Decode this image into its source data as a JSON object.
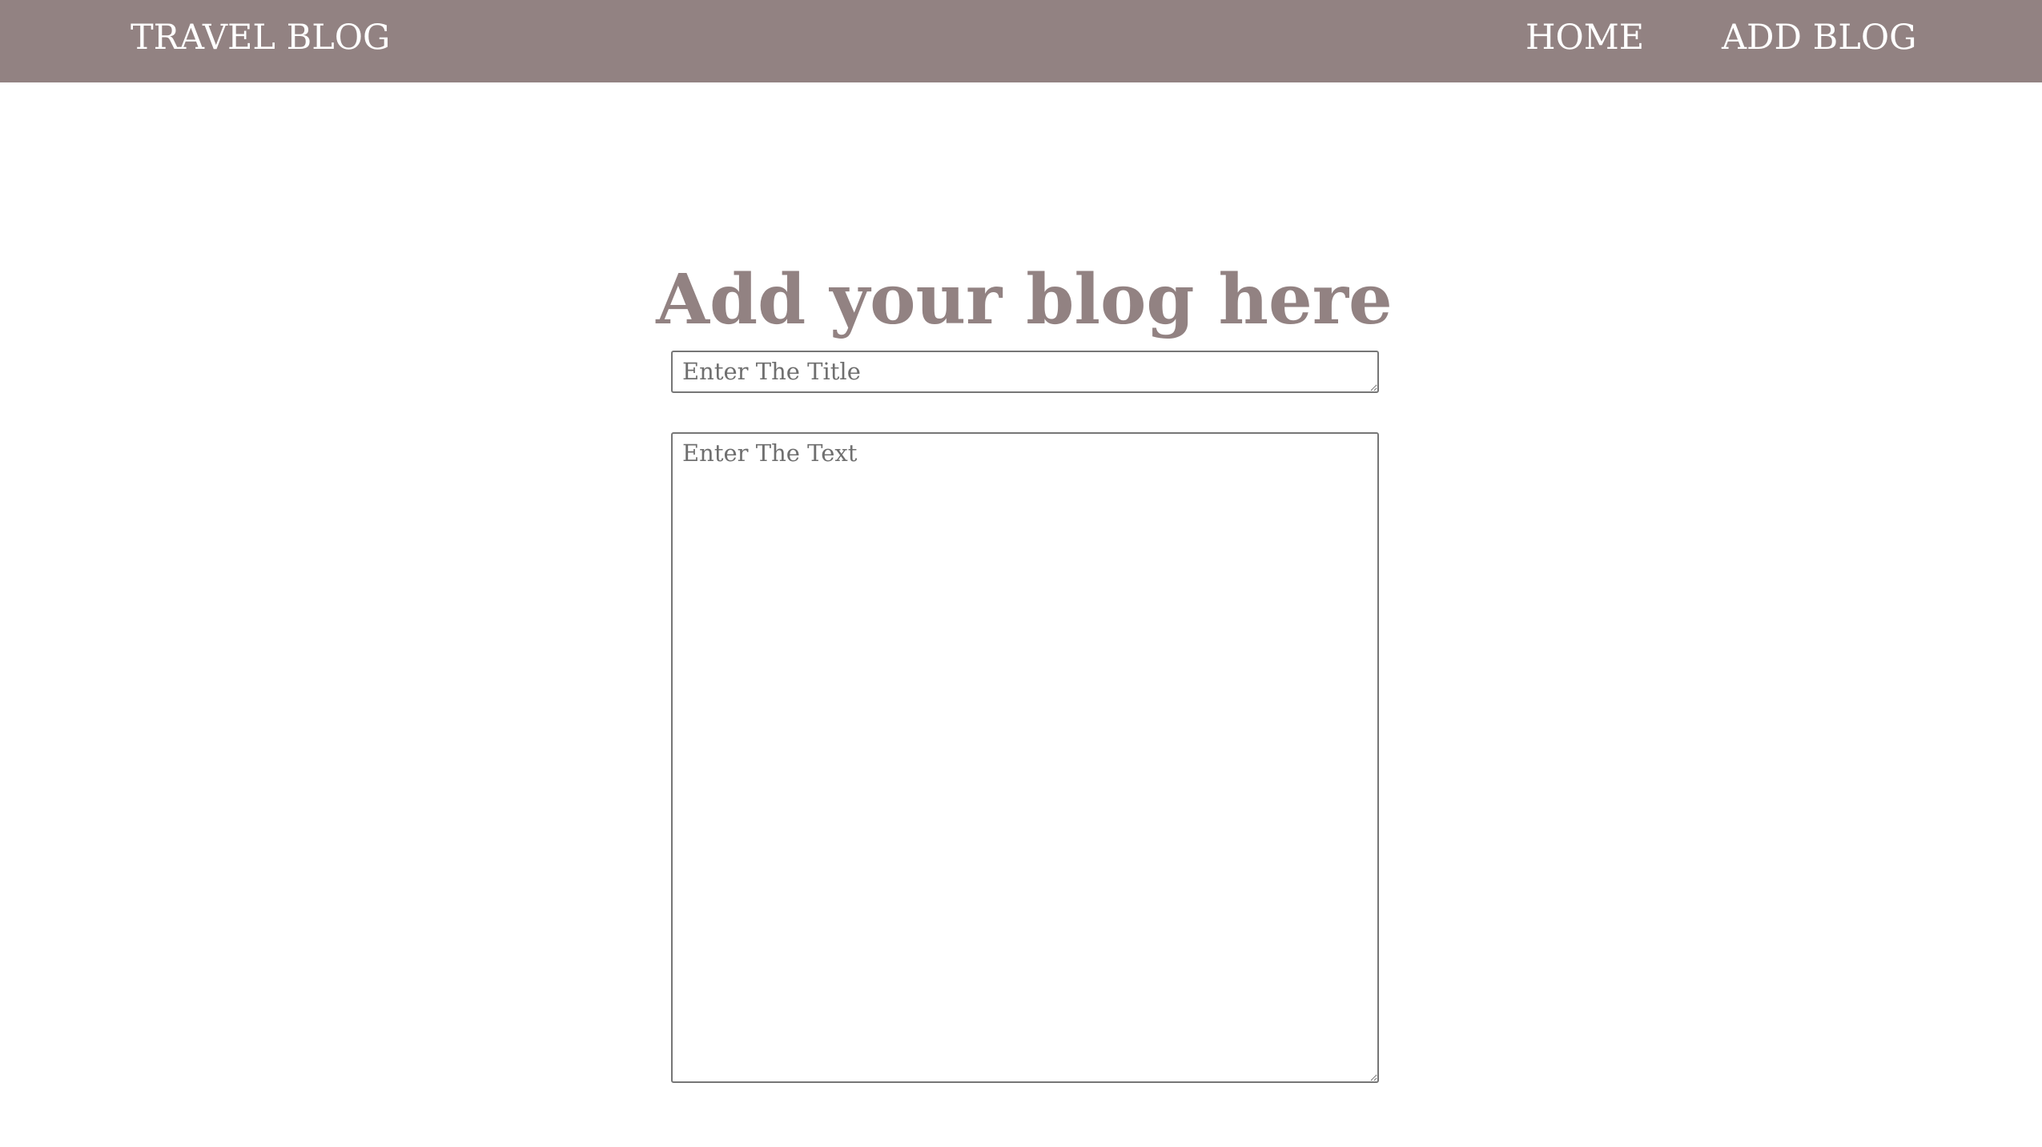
{
  "navbar": {
    "brand": "TRAVEL BLOG",
    "links": [
      {
        "label": "HOME"
      },
      {
        "label": "ADD BLOG"
      }
    ],
    "background_color": "#928282",
    "text_color": "#ffffff"
  },
  "main": {
    "heading": "Add your blog here",
    "heading_color": "#928282",
    "title_field": {
      "placeholder": "Enter The Title",
      "value": ""
    },
    "text_field": {
      "placeholder": "Enter The Text",
      "value": ""
    }
  }
}
